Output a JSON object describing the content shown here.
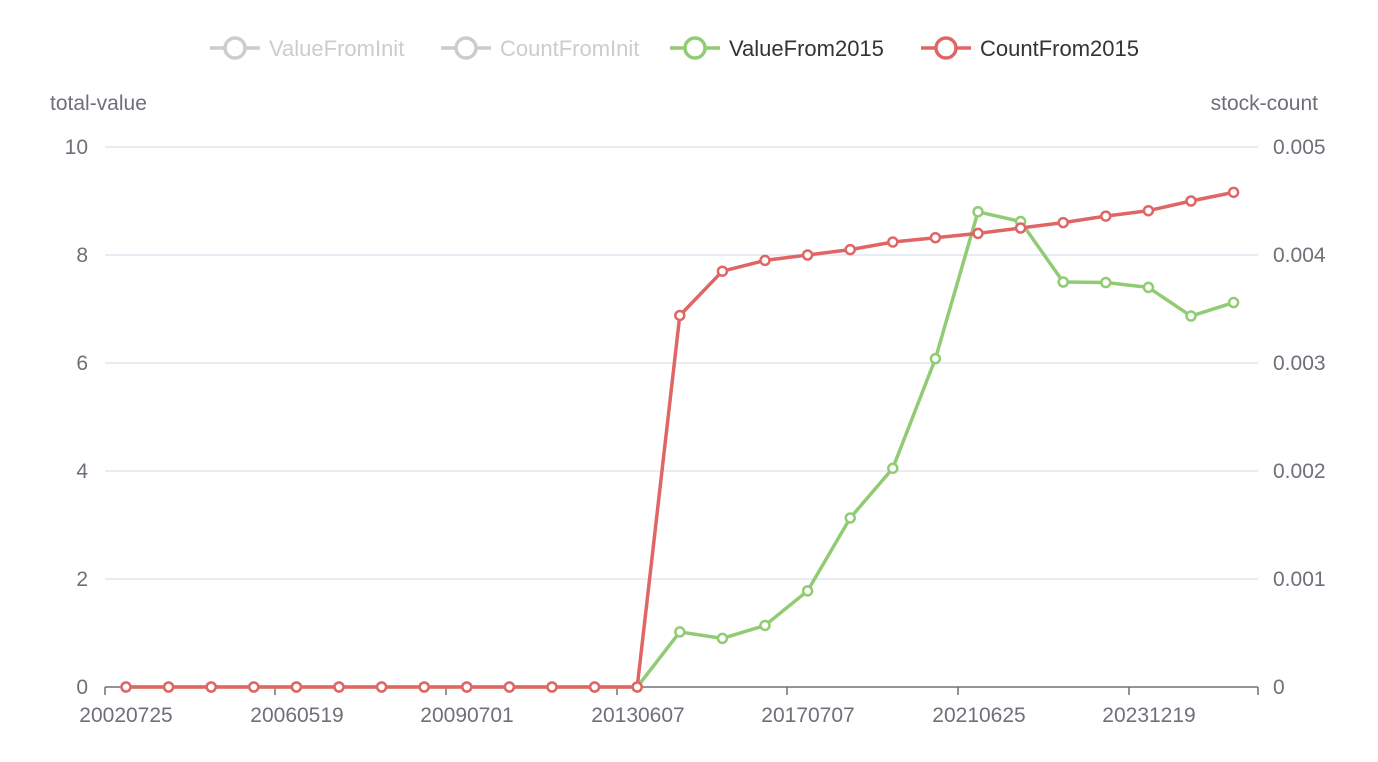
{
  "chart_data": {
    "type": "line",
    "legend": {
      "placement": "top-center",
      "items": [
        {
          "name": "ValueFromInit",
          "color": "#cccccc",
          "active": false
        },
        {
          "name": "CountFromInit",
          "color": "#cccccc",
          "active": false
        },
        {
          "name": "ValueFrom2015",
          "color": "#91cc75",
          "active": true
        },
        {
          "name": "CountFrom2015",
          "color": "#e06666",
          "active": true
        }
      ]
    },
    "x_tick_labels": [
      "20020725",
      "20060519",
      "20090701",
      "20130607",
      "20170707",
      "20210625",
      "20231219"
    ],
    "x_point_count": 27,
    "y_left": {
      "name": "total-value",
      "min": 0,
      "max": 10,
      "ticks": [
        "0",
        "2",
        "4",
        "6",
        "8",
        "10"
      ]
    },
    "y_right": {
      "name": "stock-count",
      "min": 0,
      "max": 0.005,
      "ticks": [
        "0",
        "0.001",
        "0.002",
        "0.003",
        "0.004",
        "0.005"
      ]
    },
    "grid": true,
    "series": [
      {
        "name": "ValueFrom2015",
        "axis": "left",
        "color": "#91cc75",
        "values": [
          0,
          0,
          0,
          0,
          0,
          0,
          0,
          0,
          0,
          0,
          0,
          0,
          0,
          1.02,
          0.9,
          1.14,
          1.78,
          3.13,
          4.05,
          6.08,
          8.8,
          8.62,
          7.5,
          7.49,
          7.4,
          6.87,
          7.12
        ]
      },
      {
        "name": "CountFrom2015",
        "axis": "right",
        "color": "#e06666",
        "values": [
          0,
          0,
          0,
          0,
          0,
          0,
          0,
          0,
          0,
          0,
          0,
          0,
          0,
          0.00344,
          0.00385,
          0.00395,
          0.004,
          0.00405,
          0.00412,
          0.00416,
          0.0042,
          0.00425,
          0.0043,
          0.00436,
          0.00441,
          0.0045,
          0.00458
        ]
      }
    ]
  }
}
